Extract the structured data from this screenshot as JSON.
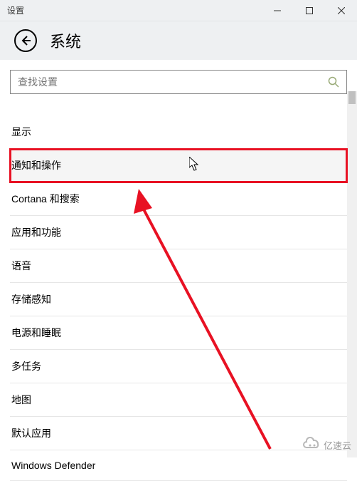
{
  "window": {
    "title": "设置"
  },
  "header": {
    "page_title": "系统"
  },
  "search": {
    "placeholder": "查找设置"
  },
  "list": {
    "items": [
      {
        "label": "显示",
        "highlighted": false
      },
      {
        "label": "通知和操作",
        "highlighted": true
      },
      {
        "label": "Cortana 和搜索",
        "highlighted": false
      },
      {
        "label": "应用和功能",
        "highlighted": false
      },
      {
        "label": "语音",
        "highlighted": false
      },
      {
        "label": "存储感知",
        "highlighted": false
      },
      {
        "label": "电源和睡眠",
        "highlighted": false
      },
      {
        "label": "多任务",
        "highlighted": false
      },
      {
        "label": "地图",
        "highlighted": false
      },
      {
        "label": "默认应用",
        "highlighted": false
      },
      {
        "label": "Windows Defender",
        "highlighted": false
      }
    ]
  },
  "watermark": {
    "text": "亿速云"
  }
}
